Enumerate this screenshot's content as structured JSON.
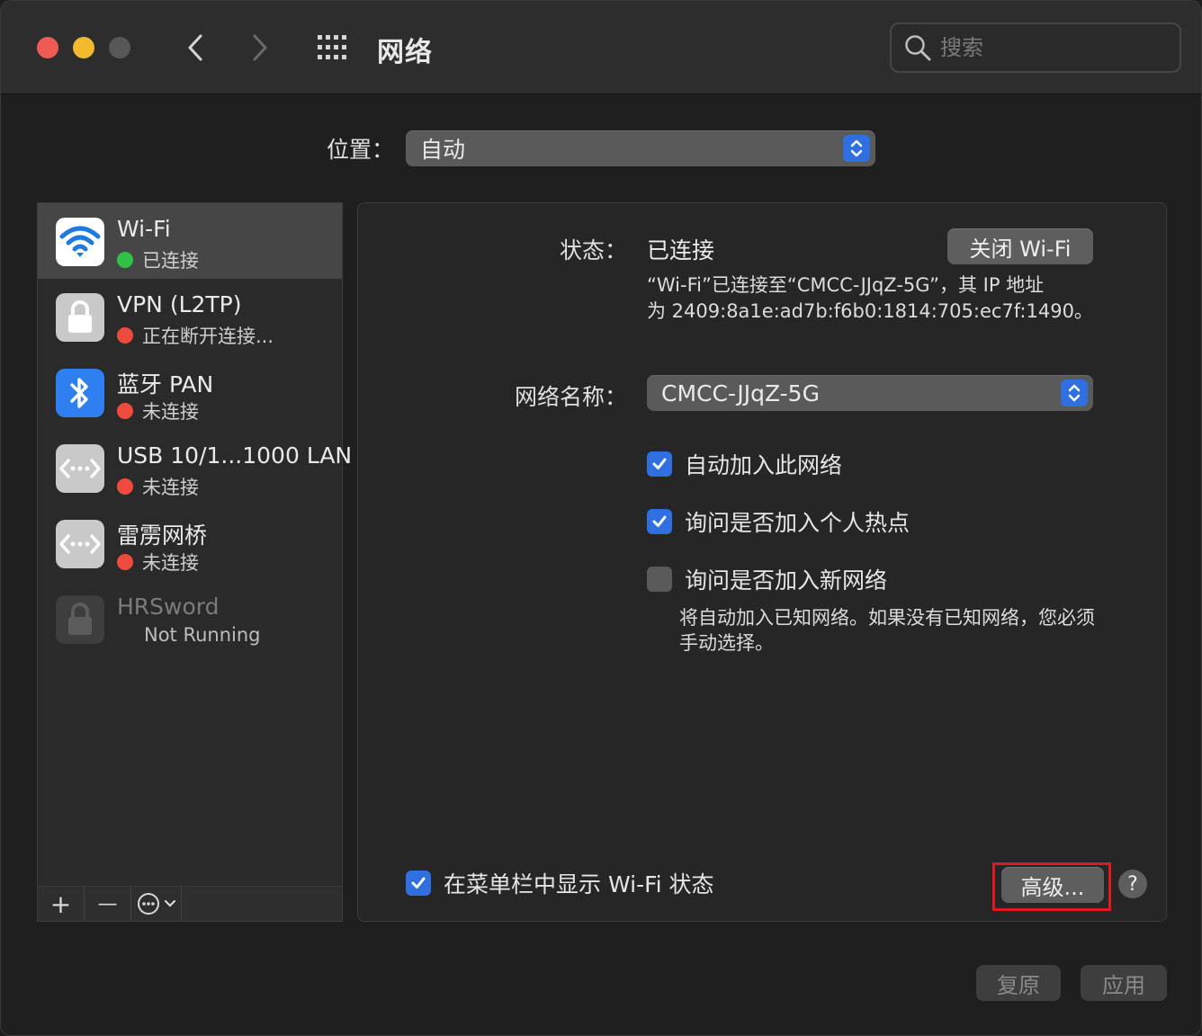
{
  "window": {
    "title": "网络",
    "search_placeholder": "搜索"
  },
  "location": {
    "label": "位置：",
    "value": "自动"
  },
  "services": [
    {
      "name": "Wi-Fi",
      "status": "已连接",
      "status_color": "#32c148",
      "icon": "wifi-icon",
      "selected": true
    },
    {
      "name": "VPN (L2TP)",
      "status": "正在断开连接...",
      "status_color": "#ee4b3f",
      "icon": "lock-icon"
    },
    {
      "name": "蓝牙 PAN",
      "status": "未连接",
      "status_color": "#ee4b3f",
      "icon": "bluetooth-icon"
    },
    {
      "name": "USB 10/1...1000 LAN",
      "status": "未连接",
      "status_color": "#ee4b3f",
      "icon": "ethernet-icon"
    },
    {
      "name": "雷雳网桥",
      "status": "未连接",
      "status_color": "#ee4b3f",
      "icon": "ethernet-icon"
    },
    {
      "name": "HRSword",
      "status": "Not Running",
      "icon": "lock-icon",
      "disabled": true
    }
  ],
  "sidebar_toolbar": {
    "add": "+",
    "remove": "—"
  },
  "detail": {
    "status_label": "状态：",
    "status_value": "已连接",
    "toggle_wifi_button": "关闭 Wi-Fi",
    "status_desc_line1": "“Wi-Fi”已连接至“CMCC-JJqZ-5G”，其 IP 地址",
    "status_desc_line2": "为 2409:8a1e:ad7b:f6b0:1814:705:ec7f:1490。",
    "network_name_label": "网络名称：",
    "network_name_value": "CMCC-JJqZ-5G",
    "auto_join_label": "自动加入此网络",
    "ask_hotspot_label": "询问是否加入个人热点",
    "ask_new_label": "询问是否加入新网络",
    "ask_new_desc_line1": "将自动加入已知网络。如果没有已知网络，您必须",
    "ask_new_desc_line2": "手动选择。",
    "show_menubar_label": "在菜单栏中显示 Wi-Fi 状态",
    "advanced_button": "高级...",
    "help_button": "?"
  },
  "footer": {
    "revert_button": "复原",
    "apply_button": "应用"
  },
  "colors": {
    "accent": "#2f6fe0",
    "highlight": "#e0191f"
  }
}
